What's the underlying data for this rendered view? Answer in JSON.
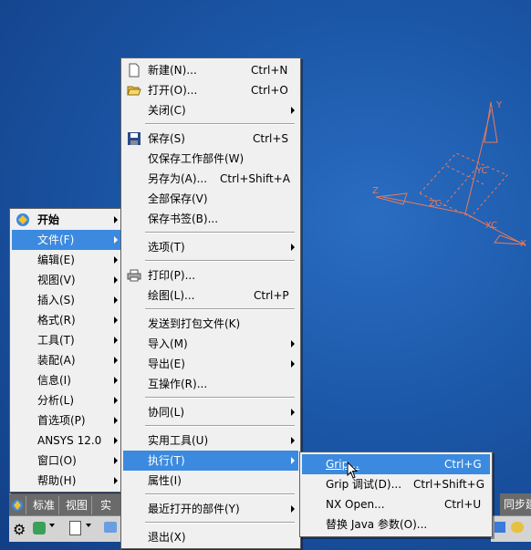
{
  "start_menu": {
    "items": [
      {
        "label": "开始",
        "bold": true
      },
      {
        "label": "文件(F)"
      },
      {
        "label": "编辑(E)"
      },
      {
        "label": "视图(V)"
      },
      {
        "label": "插入(S)"
      },
      {
        "label": "格式(R)"
      },
      {
        "label": "工具(T)"
      },
      {
        "label": "装配(A)"
      },
      {
        "label": "信息(I)"
      },
      {
        "label": "分析(L)"
      },
      {
        "label": "首选项(P)"
      },
      {
        "label": "ANSYS 12.0"
      },
      {
        "label": "窗口(O)"
      },
      {
        "label": "帮助(H)"
      }
    ]
  },
  "file_menu": {
    "items": [
      {
        "label": "新建(N)...",
        "shortcut": "Ctrl+N"
      },
      {
        "label": "打开(O)...",
        "shortcut": "Ctrl+O"
      },
      {
        "label": "关闭(C)"
      },
      {
        "label": "保存(S)",
        "shortcut": "Ctrl+S"
      },
      {
        "label": "仅保存工作部件(W)"
      },
      {
        "label": "另存为(A)...",
        "shortcut": "Ctrl+Shift+A"
      },
      {
        "label": "全部保存(V)"
      },
      {
        "label": "保存书签(B)..."
      },
      {
        "label": "选项(T)"
      },
      {
        "label": "打印(P)..."
      },
      {
        "label": "绘图(L)...",
        "shortcut": "Ctrl+P"
      },
      {
        "label": "发送到打包文件(K)"
      },
      {
        "label": "导入(M)"
      },
      {
        "label": "导出(E)"
      },
      {
        "label": "互操作(R)..."
      },
      {
        "label": "协同(L)"
      },
      {
        "label": "实用工具(U)"
      },
      {
        "label": "执行(T)"
      },
      {
        "label": "属性(I)"
      },
      {
        "label": "最近打开的部件(Y)"
      },
      {
        "label": "退出(X)"
      }
    ]
  },
  "exec_menu": {
    "items": [
      {
        "label": "Grip...",
        "shortcut": "Ctrl+G"
      },
      {
        "label": "Grip 调试(D)...",
        "shortcut": "Ctrl+Shift+G"
      },
      {
        "label": "NX Open...",
        "shortcut": "Ctrl+U"
      },
      {
        "label": "替换 Java 参数(O)..."
      }
    ]
  },
  "toolbar": {
    "tab1": "标准",
    "tab2": "视图",
    "tab3": "实",
    "right_tab": "同步建"
  },
  "axes": {
    "x": "X",
    "y": "Y",
    "z": "Z",
    "xc": "XC",
    "yc": "YC",
    "zc": "ZC"
  },
  "colors": {
    "background": "#1c58a8",
    "highlight": "#3b8ae0",
    "axis": "#e87a5a"
  }
}
